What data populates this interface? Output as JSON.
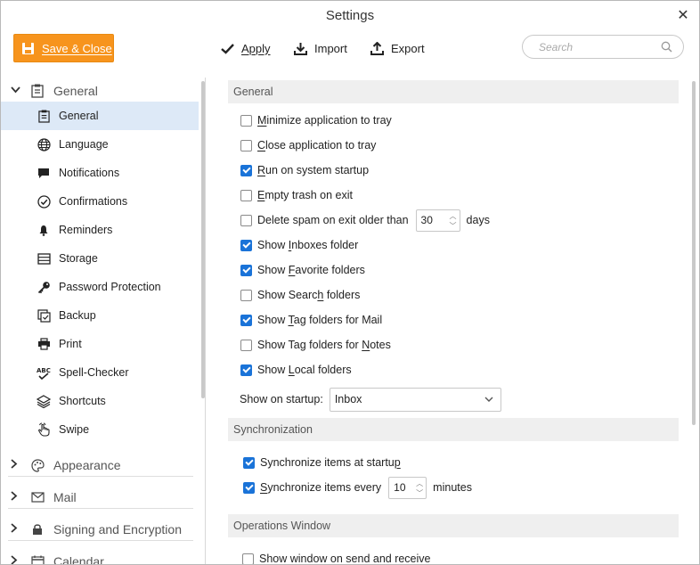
{
  "window": {
    "title": "Settings"
  },
  "toolbar": {
    "save_label": "Save & Close",
    "apply_label": "Apply",
    "import_label": "Import",
    "export_label": "Export",
    "search_placeholder": "Search"
  },
  "accent_color": "#f7941d",
  "checkbox_color": "#1a73d8",
  "sidebar": {
    "general_group": "General",
    "items": [
      {
        "label": "General",
        "icon": "clipboard-icon",
        "active": true
      },
      {
        "label": "Language",
        "icon": "globe-icon"
      },
      {
        "label": "Notifications",
        "icon": "speech-bubble-icon"
      },
      {
        "label": "Confirmations",
        "icon": "check-circle-icon"
      },
      {
        "label": "Reminders",
        "icon": "bell-icon"
      },
      {
        "label": "Storage",
        "icon": "storage-icon"
      },
      {
        "label": "Password Protection",
        "icon": "key-icon"
      },
      {
        "label": "Backup",
        "icon": "backup-icon"
      },
      {
        "label": "Print",
        "icon": "printer-icon"
      },
      {
        "label": "Spell-Checker",
        "icon": "spell-check-icon"
      },
      {
        "label": "Shortcuts",
        "icon": "layers-icon"
      },
      {
        "label": "Swipe",
        "icon": "swipe-hand-icon"
      }
    ],
    "groups": [
      {
        "label": "Appearance",
        "icon": "palette-icon"
      },
      {
        "label": "Mail",
        "icon": "envelope-icon"
      },
      {
        "label": "Signing and Encryption",
        "icon": "lock-icon"
      },
      {
        "label": "Calendar",
        "icon": "calendar-icon"
      }
    ]
  },
  "general_section": {
    "title": "General",
    "options": [
      {
        "pre": "",
        "acc": "M",
        "post": "inimize application to tray",
        "checked": false
      },
      {
        "pre": "",
        "acc": "C",
        "post": "lose application to tray",
        "checked": false
      },
      {
        "pre": "",
        "acc": "R",
        "post": "un on system startup",
        "checked": true
      },
      {
        "pre": "",
        "acc": "E",
        "post": "mpty trash on exit",
        "checked": false
      }
    ],
    "spam": {
      "label": "Delete spam on exit older than",
      "value": "30",
      "unit": "days",
      "checked": false
    },
    "folders": [
      {
        "pre": "Show ",
        "acc": "I",
        "post": "nboxes folder",
        "checked": true
      },
      {
        "pre": "Show ",
        "acc": "F",
        "post": "avorite folders",
        "checked": true
      },
      {
        "pre": "Show Searc",
        "acc": "h",
        "post": " folders",
        "checked": false
      },
      {
        "pre": "Show ",
        "acc": "T",
        "post": "ag folders for Mail",
        "checked": true
      },
      {
        "pre": "Show Tag folders for ",
        "acc": "N",
        "post": "otes",
        "checked": false
      },
      {
        "pre": "Show ",
        "acc": "L",
        "post": "ocal folders",
        "checked": true
      }
    ],
    "startup_label": "Show on startup:",
    "startup_value": "Inbox"
  },
  "sync_section": {
    "title": "Synchronization",
    "at_startup": {
      "pre": "Synchronize items at startu",
      "acc": "p",
      "post": "",
      "checked": true
    },
    "every": {
      "pre": "",
      "acc": "S",
      "post": "ynchronize items every",
      "value": "10",
      "unit": "minutes",
      "checked": true
    }
  },
  "ops_section": {
    "title": "Operations Window",
    "show_window": {
      "pre": "Sh",
      "acc": "o",
      "post": "w window on send and receive",
      "checked": false
    }
  }
}
